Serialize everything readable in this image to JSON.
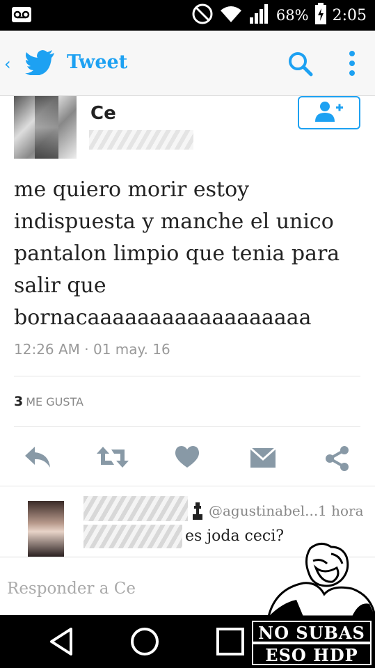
{
  "status_bar": {
    "battery_percent": "68%",
    "time": "2:05",
    "icons": [
      "voicemail-icon",
      "do-not-disturb-icon",
      "wifi-icon",
      "signal-icon",
      "battery-icon"
    ]
  },
  "app_bar": {
    "title": "Tweet",
    "icons": [
      "back-icon",
      "twitter-bird-icon",
      "search-icon",
      "overflow-menu-icon"
    ]
  },
  "tweet": {
    "author_name": "Ce",
    "text": "me quiero morir estoy indispuesta y manche el unico pantalon limpio que tenia para salir que bornacaaaaaaaaaaaaaaaaaa",
    "timestamp": "12:26 AM · 01 may. 16",
    "like_count": "3",
    "like_label": "ME GUSTA",
    "actions": [
      "reply-icon",
      "retweet-icon",
      "like-icon",
      "message-icon",
      "share-icon"
    ],
    "follow_icon": "add-user-icon"
  },
  "reply": {
    "handle": "@agustinabel...",
    "time": "1 hora",
    "text": "es joda ceci?"
  },
  "compose": {
    "placeholder": "Responder a Ce"
  },
  "watermark": {
    "line1": "NO SUBAS",
    "line2": "ESO HDP"
  },
  "colors": {
    "accent": "#1da1f2",
    "action_gray": "#8899a6",
    "text": "#222222",
    "muted": "#999999"
  }
}
